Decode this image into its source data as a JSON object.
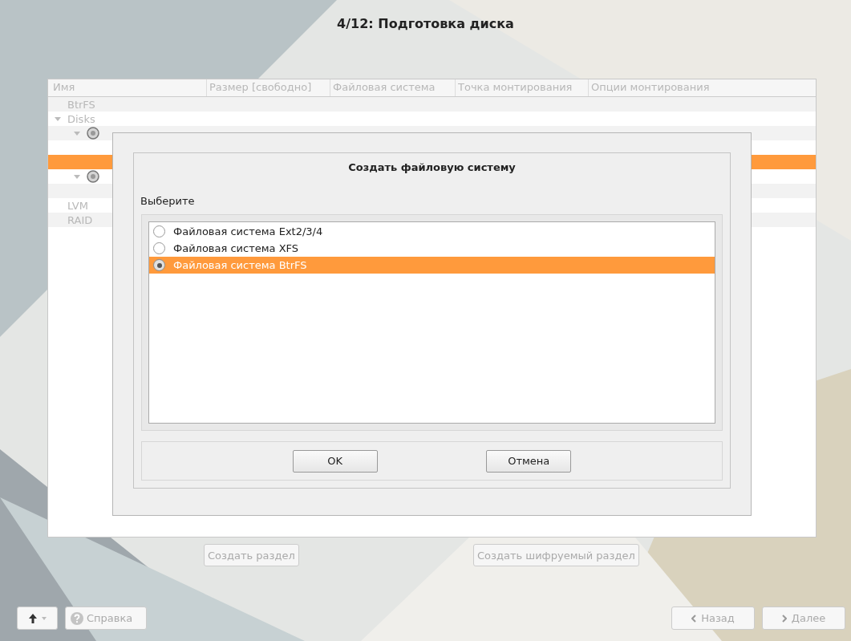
{
  "window": {
    "title": "4/12: Подготовка диска"
  },
  "table": {
    "columns": [
      "Имя",
      "Размер [свободно]",
      "Файловая система",
      "Точка монтирования",
      "Опции монтирования"
    ],
    "tree": [
      {
        "label": "BtrFS"
      },
      {
        "label": "Disks",
        "expanded": true,
        "children": [
          {
            "kind": "disk",
            "expanded": true,
            "children": [
              {
                "selected": false
              },
              {
                "selected": true
              }
            ]
          },
          {
            "kind": "disk",
            "expanded": true,
            "children": [
              {
                "selected": false
              }
            ]
          }
        ]
      },
      {
        "label": "LVM"
      },
      {
        "label": "RAID"
      }
    ]
  },
  "partition_buttons": [
    "Создать раздел",
    "Создать шифруемый раздел"
  ],
  "dialog": {
    "title": "Создать файловую систему",
    "prompt": "Выберите",
    "options": [
      {
        "label": "Файловая система Ext2/3/4",
        "selected": false
      },
      {
        "label": "Файловая система XFS",
        "selected": false
      },
      {
        "label": "Файловая система BtrFS",
        "selected": true
      }
    ],
    "buttons": [
      "OK",
      "Отмена"
    ]
  },
  "footer": {
    "help": "Справка",
    "back": "Назад",
    "next": "Далее"
  }
}
